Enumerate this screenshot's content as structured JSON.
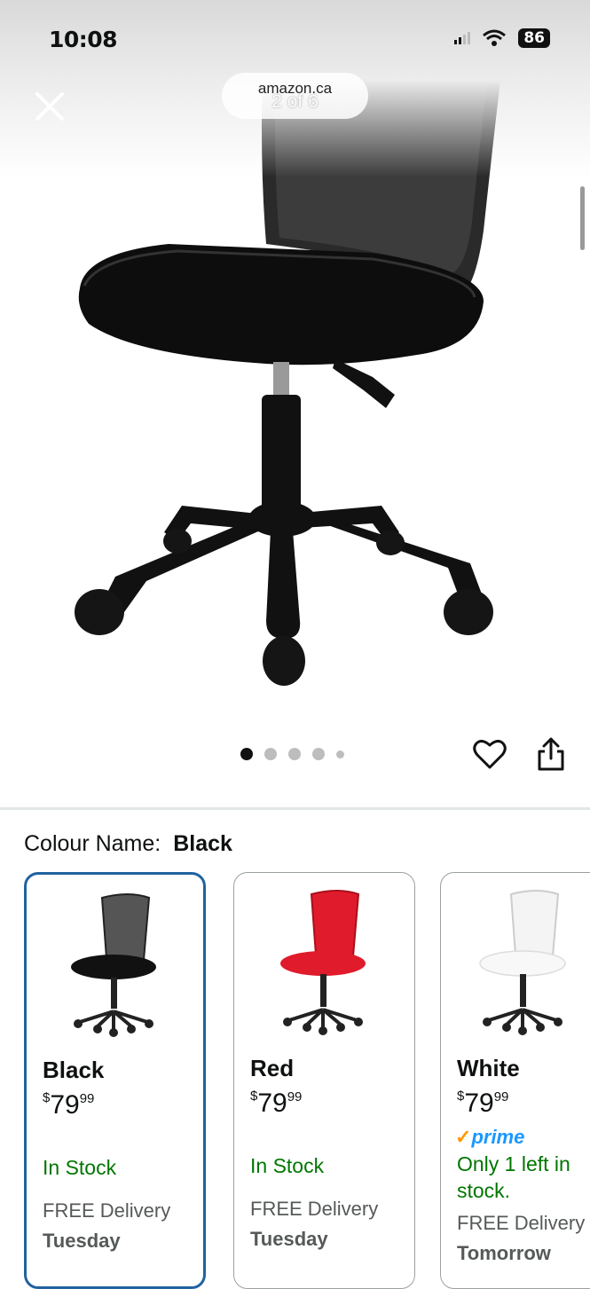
{
  "status_bar": {
    "time": "10:08",
    "battery": "86"
  },
  "browser": {
    "url": "amazon.ca",
    "image_counter": "2 of 6"
  },
  "gallery": {
    "dots": [
      true,
      false,
      false,
      false,
      false
    ]
  },
  "colour": {
    "label": "Colour Name:",
    "value": "Black"
  },
  "variants": [
    {
      "name": "Black",
      "price_symbol": "$",
      "price_whole": "79",
      "price_cents": "99",
      "stock": "In Stock",
      "delivery_label": "FREE Delivery",
      "delivery_day": "Tuesday",
      "prime": ""
    },
    {
      "name": "Red",
      "price_symbol": "$",
      "price_whole": "79",
      "price_cents": "99",
      "stock": "In Stock",
      "delivery_label": "FREE Delivery",
      "delivery_day": "Tuesday",
      "prime": ""
    },
    {
      "name": "White",
      "price_symbol": "$",
      "price_whole": "79",
      "price_cents": "99",
      "stock": "Only 1 left in stock.",
      "delivery_label": "FREE Delivery",
      "delivery_day": "Tomorrow",
      "prime": "prime"
    }
  ],
  "colors": {
    "selected_border": "#2162a1",
    "in_stock": "#007600",
    "prime_blue": "#1a98ff",
    "prime_check": "#ff9900"
  },
  "icons": {
    "close": "close-icon",
    "favorite": "heart-icon",
    "share": "share-icon",
    "wifi": "wifi-icon",
    "signal": "signal-icon"
  }
}
